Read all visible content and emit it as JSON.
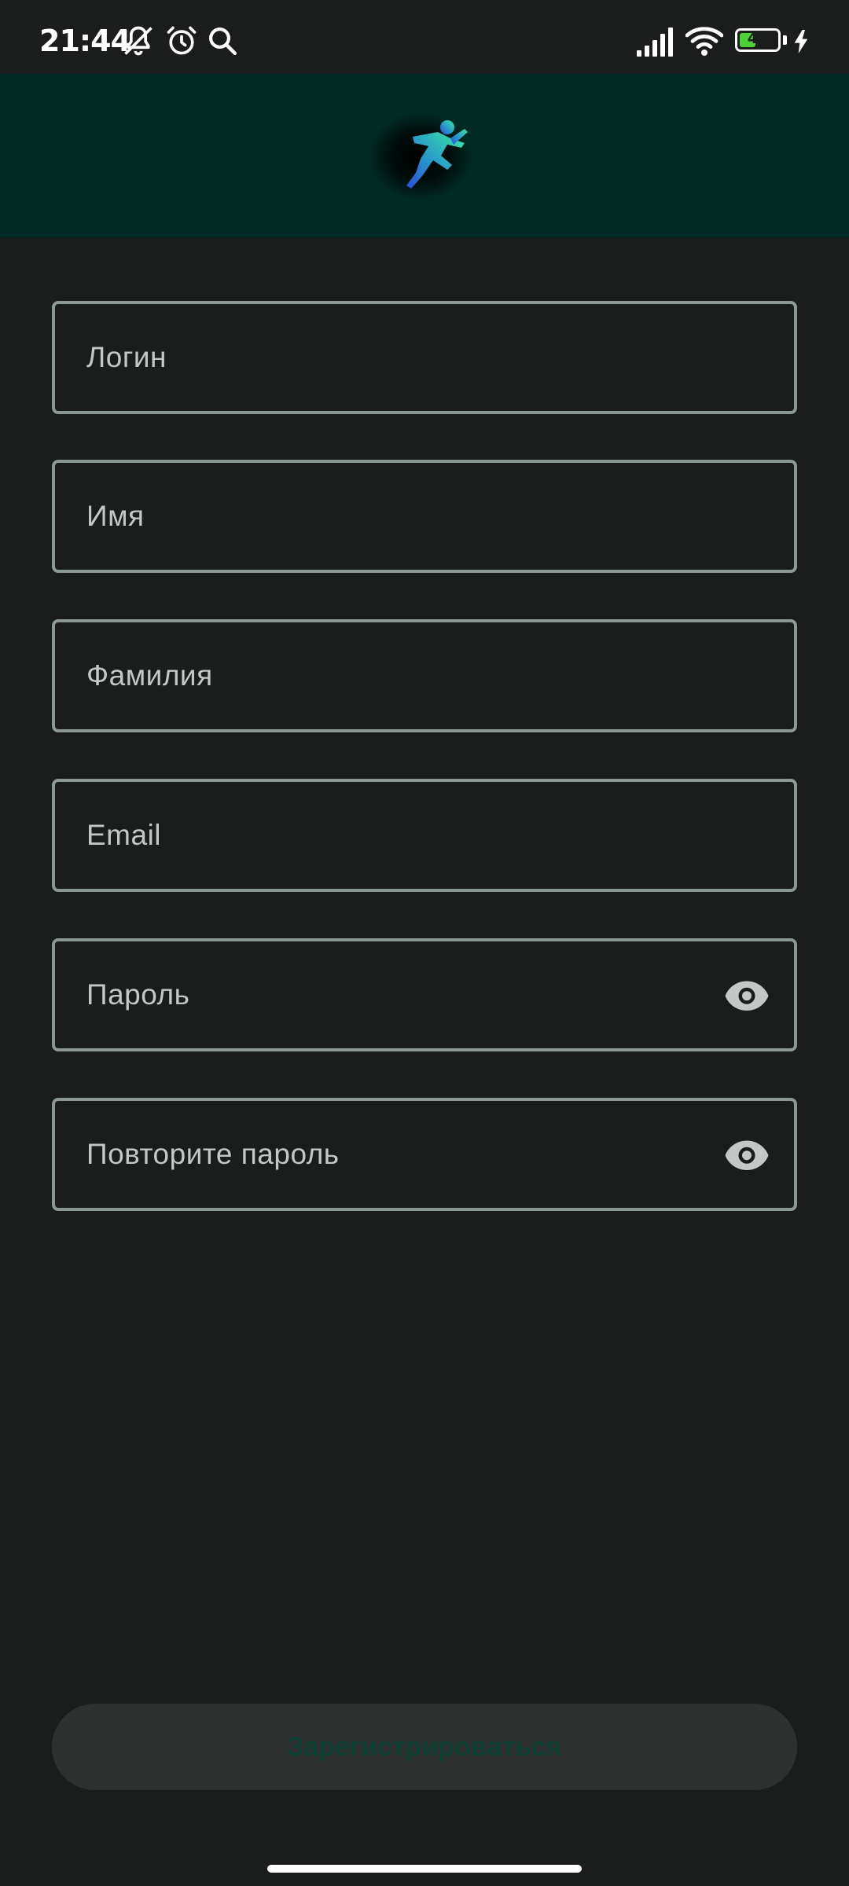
{
  "status_bar": {
    "time": "21:44",
    "battery_level": "44",
    "battery_fraction": 0.44,
    "icons": [
      "muted-bell-icon",
      "alarm-icon",
      "search-icon",
      "signal-icon",
      "wifi-icon",
      "battery-icon",
      "charging-icon"
    ]
  },
  "header": {
    "logo_icon": "running-person-logo",
    "background": "#002a24"
  },
  "form": {
    "login_label": "Логин",
    "first_name_label": "Имя",
    "last_name_label": "Фамилия",
    "email_label": "Email",
    "password_label": "Пароль",
    "repeat_password_label": "Повторите пароль",
    "visibility_icon": "eye-icon"
  },
  "actions": {
    "register_label": "Зарегистрироваться"
  },
  "colors": {
    "background": "#1b1c1c",
    "field_border": "#8b9894",
    "button_background": "#2e3130",
    "button_text": "#0d3f33",
    "accent": "#2fd6a0"
  }
}
